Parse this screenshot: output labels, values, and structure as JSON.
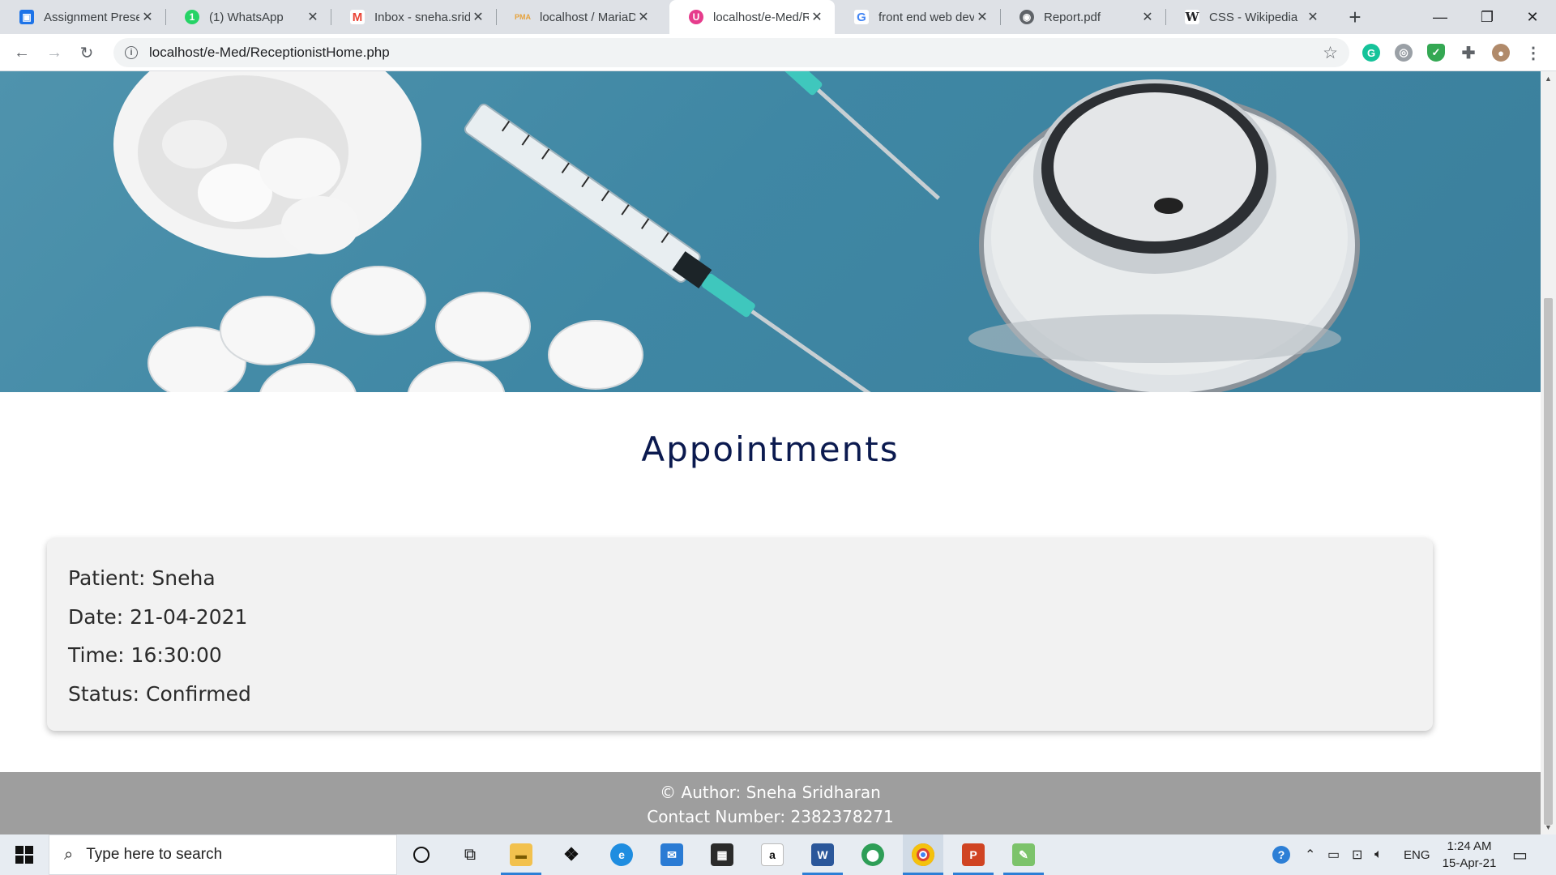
{
  "browser": {
    "tabs": [
      {
        "title": "Assignment Preser",
        "icon": "google-classroom-icon",
        "color": "#1e74e8"
      },
      {
        "title": "(1) WhatsApp",
        "icon": "whatsapp-icon",
        "color": "#25d366"
      },
      {
        "title": "Inbox - sneha.sridh",
        "icon": "gmail-icon",
        "color": "#ea4335"
      },
      {
        "title": "localhost / MariaD",
        "icon": "phpmyadmin-icon",
        "color": "#e6a23c"
      },
      {
        "title": "localhost/e-Med/R",
        "icon": "emed-icon",
        "color": "#e63c8c",
        "active": true
      },
      {
        "title": "front end web dev",
        "icon": "google-icon",
        "color": "#4285f4"
      },
      {
        "title": "Report.pdf",
        "icon": "globe-icon",
        "color": "#5f6368"
      },
      {
        "title": "CSS - Wikipedia",
        "icon": "wikipedia-icon",
        "color": "#202124"
      }
    ],
    "url": "localhost/e-Med/ReceptionistHome.php"
  },
  "page": {
    "title": "Appointments",
    "appointment": {
      "patient": "Patient: Sneha",
      "date": "Date: 21-04-2021",
      "time": "Time: 16:30:00",
      "status": "Status: Confirmed"
    },
    "footer": {
      "author": "© Author: Sneha Sridharan",
      "contact": "Contact Number: 2382378271"
    }
  },
  "taskbar": {
    "search_placeholder": "Type here to search",
    "language": "ENG",
    "time": "1:24 AM",
    "date": "15-Apr-21"
  },
  "colors": {
    "title": "#0b1a4f",
    "footer_bg": "#9e9e9e",
    "card_bg": "#f2f2f2",
    "hero_bg": "#3f87a4"
  }
}
